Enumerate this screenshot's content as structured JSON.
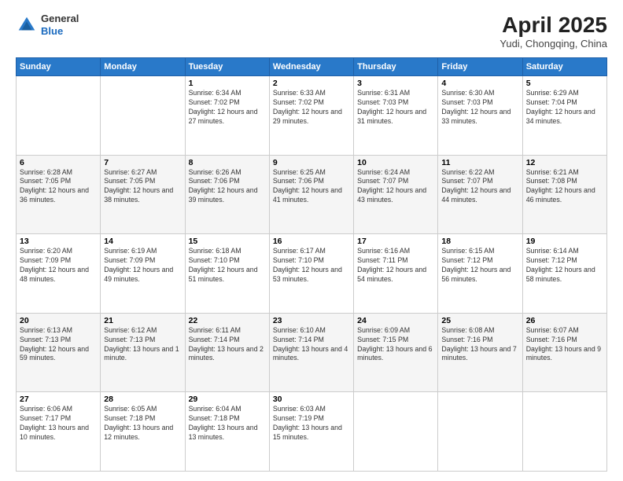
{
  "header": {
    "logo_line1": "General",
    "logo_line2": "Blue",
    "month_year": "April 2025",
    "location": "Yudi, Chongqing, China"
  },
  "days_of_week": [
    "Sunday",
    "Monday",
    "Tuesday",
    "Wednesday",
    "Thursday",
    "Friday",
    "Saturday"
  ],
  "weeks": [
    [
      {
        "day": "",
        "sunrise": "",
        "sunset": "",
        "daylight": ""
      },
      {
        "day": "",
        "sunrise": "",
        "sunset": "",
        "daylight": ""
      },
      {
        "day": "1",
        "sunrise": "Sunrise: 6:34 AM",
        "sunset": "Sunset: 7:02 PM",
        "daylight": "Daylight: 12 hours and 27 minutes."
      },
      {
        "day": "2",
        "sunrise": "Sunrise: 6:33 AM",
        "sunset": "Sunset: 7:02 PM",
        "daylight": "Daylight: 12 hours and 29 minutes."
      },
      {
        "day": "3",
        "sunrise": "Sunrise: 6:31 AM",
        "sunset": "Sunset: 7:03 PM",
        "daylight": "Daylight: 12 hours and 31 minutes."
      },
      {
        "day": "4",
        "sunrise": "Sunrise: 6:30 AM",
        "sunset": "Sunset: 7:03 PM",
        "daylight": "Daylight: 12 hours and 33 minutes."
      },
      {
        "day": "5",
        "sunrise": "Sunrise: 6:29 AM",
        "sunset": "Sunset: 7:04 PM",
        "daylight": "Daylight: 12 hours and 34 minutes."
      }
    ],
    [
      {
        "day": "6",
        "sunrise": "Sunrise: 6:28 AM",
        "sunset": "Sunset: 7:05 PM",
        "daylight": "Daylight: 12 hours and 36 minutes."
      },
      {
        "day": "7",
        "sunrise": "Sunrise: 6:27 AM",
        "sunset": "Sunset: 7:05 PM",
        "daylight": "Daylight: 12 hours and 38 minutes."
      },
      {
        "day": "8",
        "sunrise": "Sunrise: 6:26 AM",
        "sunset": "Sunset: 7:06 PM",
        "daylight": "Daylight: 12 hours and 39 minutes."
      },
      {
        "day": "9",
        "sunrise": "Sunrise: 6:25 AM",
        "sunset": "Sunset: 7:06 PM",
        "daylight": "Daylight: 12 hours and 41 minutes."
      },
      {
        "day": "10",
        "sunrise": "Sunrise: 6:24 AM",
        "sunset": "Sunset: 7:07 PM",
        "daylight": "Daylight: 12 hours and 43 minutes."
      },
      {
        "day": "11",
        "sunrise": "Sunrise: 6:22 AM",
        "sunset": "Sunset: 7:07 PM",
        "daylight": "Daylight: 12 hours and 44 minutes."
      },
      {
        "day": "12",
        "sunrise": "Sunrise: 6:21 AM",
        "sunset": "Sunset: 7:08 PM",
        "daylight": "Daylight: 12 hours and 46 minutes."
      }
    ],
    [
      {
        "day": "13",
        "sunrise": "Sunrise: 6:20 AM",
        "sunset": "Sunset: 7:09 PM",
        "daylight": "Daylight: 12 hours and 48 minutes."
      },
      {
        "day": "14",
        "sunrise": "Sunrise: 6:19 AM",
        "sunset": "Sunset: 7:09 PM",
        "daylight": "Daylight: 12 hours and 49 minutes."
      },
      {
        "day": "15",
        "sunrise": "Sunrise: 6:18 AM",
        "sunset": "Sunset: 7:10 PM",
        "daylight": "Daylight: 12 hours and 51 minutes."
      },
      {
        "day": "16",
        "sunrise": "Sunrise: 6:17 AM",
        "sunset": "Sunset: 7:10 PM",
        "daylight": "Daylight: 12 hours and 53 minutes."
      },
      {
        "day": "17",
        "sunrise": "Sunrise: 6:16 AM",
        "sunset": "Sunset: 7:11 PM",
        "daylight": "Daylight: 12 hours and 54 minutes."
      },
      {
        "day": "18",
        "sunrise": "Sunrise: 6:15 AM",
        "sunset": "Sunset: 7:12 PM",
        "daylight": "Daylight: 12 hours and 56 minutes."
      },
      {
        "day": "19",
        "sunrise": "Sunrise: 6:14 AM",
        "sunset": "Sunset: 7:12 PM",
        "daylight": "Daylight: 12 hours and 58 minutes."
      }
    ],
    [
      {
        "day": "20",
        "sunrise": "Sunrise: 6:13 AM",
        "sunset": "Sunset: 7:13 PM",
        "daylight": "Daylight: 12 hours and 59 minutes."
      },
      {
        "day": "21",
        "sunrise": "Sunrise: 6:12 AM",
        "sunset": "Sunset: 7:13 PM",
        "daylight": "Daylight: 13 hours and 1 minute."
      },
      {
        "day": "22",
        "sunrise": "Sunrise: 6:11 AM",
        "sunset": "Sunset: 7:14 PM",
        "daylight": "Daylight: 13 hours and 2 minutes."
      },
      {
        "day": "23",
        "sunrise": "Sunrise: 6:10 AM",
        "sunset": "Sunset: 7:14 PM",
        "daylight": "Daylight: 13 hours and 4 minutes."
      },
      {
        "day": "24",
        "sunrise": "Sunrise: 6:09 AM",
        "sunset": "Sunset: 7:15 PM",
        "daylight": "Daylight: 13 hours and 6 minutes."
      },
      {
        "day": "25",
        "sunrise": "Sunrise: 6:08 AM",
        "sunset": "Sunset: 7:16 PM",
        "daylight": "Daylight: 13 hours and 7 minutes."
      },
      {
        "day": "26",
        "sunrise": "Sunrise: 6:07 AM",
        "sunset": "Sunset: 7:16 PM",
        "daylight": "Daylight: 13 hours and 9 minutes."
      }
    ],
    [
      {
        "day": "27",
        "sunrise": "Sunrise: 6:06 AM",
        "sunset": "Sunset: 7:17 PM",
        "daylight": "Daylight: 13 hours and 10 minutes."
      },
      {
        "day": "28",
        "sunrise": "Sunrise: 6:05 AM",
        "sunset": "Sunset: 7:18 PM",
        "daylight": "Daylight: 13 hours and 12 minutes."
      },
      {
        "day": "29",
        "sunrise": "Sunrise: 6:04 AM",
        "sunset": "Sunset: 7:18 PM",
        "daylight": "Daylight: 13 hours and 13 minutes."
      },
      {
        "day": "30",
        "sunrise": "Sunrise: 6:03 AM",
        "sunset": "Sunset: 7:19 PM",
        "daylight": "Daylight: 13 hours and 15 minutes."
      },
      {
        "day": "",
        "sunrise": "",
        "sunset": "",
        "daylight": ""
      },
      {
        "day": "",
        "sunrise": "",
        "sunset": "",
        "daylight": ""
      },
      {
        "day": "",
        "sunrise": "",
        "sunset": "",
        "daylight": ""
      }
    ]
  ]
}
